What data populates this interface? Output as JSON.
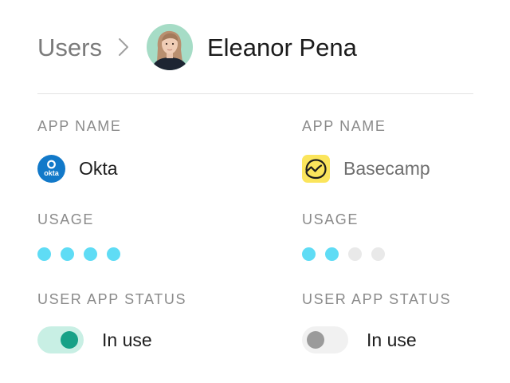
{
  "breadcrumb": {
    "parent_label": "Users",
    "user_name": "Eleanor Pena"
  },
  "apps": [
    {
      "app_name_label": "APP NAME",
      "name": "Okta",
      "icon": "okta-logo-icon",
      "icon_text": "okta",
      "usage_label": "USAGE",
      "usage_level": 4,
      "usage_max": 4,
      "status_label": "USER APP STATUS",
      "status_text": "In use",
      "status_enabled": true
    },
    {
      "app_name_label": "APP NAME",
      "name": "Basecamp",
      "icon": "basecamp-logo-icon",
      "usage_label": "USAGE",
      "usage_level": 2,
      "usage_max": 4,
      "status_label": "USER APP STATUS",
      "status_text": "In use",
      "status_enabled": false
    }
  ],
  "colors": {
    "usage_filled": "#5fdcf5",
    "usage_empty": "#e9e9e9",
    "toggle_on_track": "#c8efe4",
    "toggle_on_knob": "#17a187",
    "toggle_off_track": "#f1f1f1",
    "toggle_off_knob": "#9b9b9b",
    "okta_blue": "#1279c9",
    "basecamp_yellow": "#fbe55c"
  }
}
